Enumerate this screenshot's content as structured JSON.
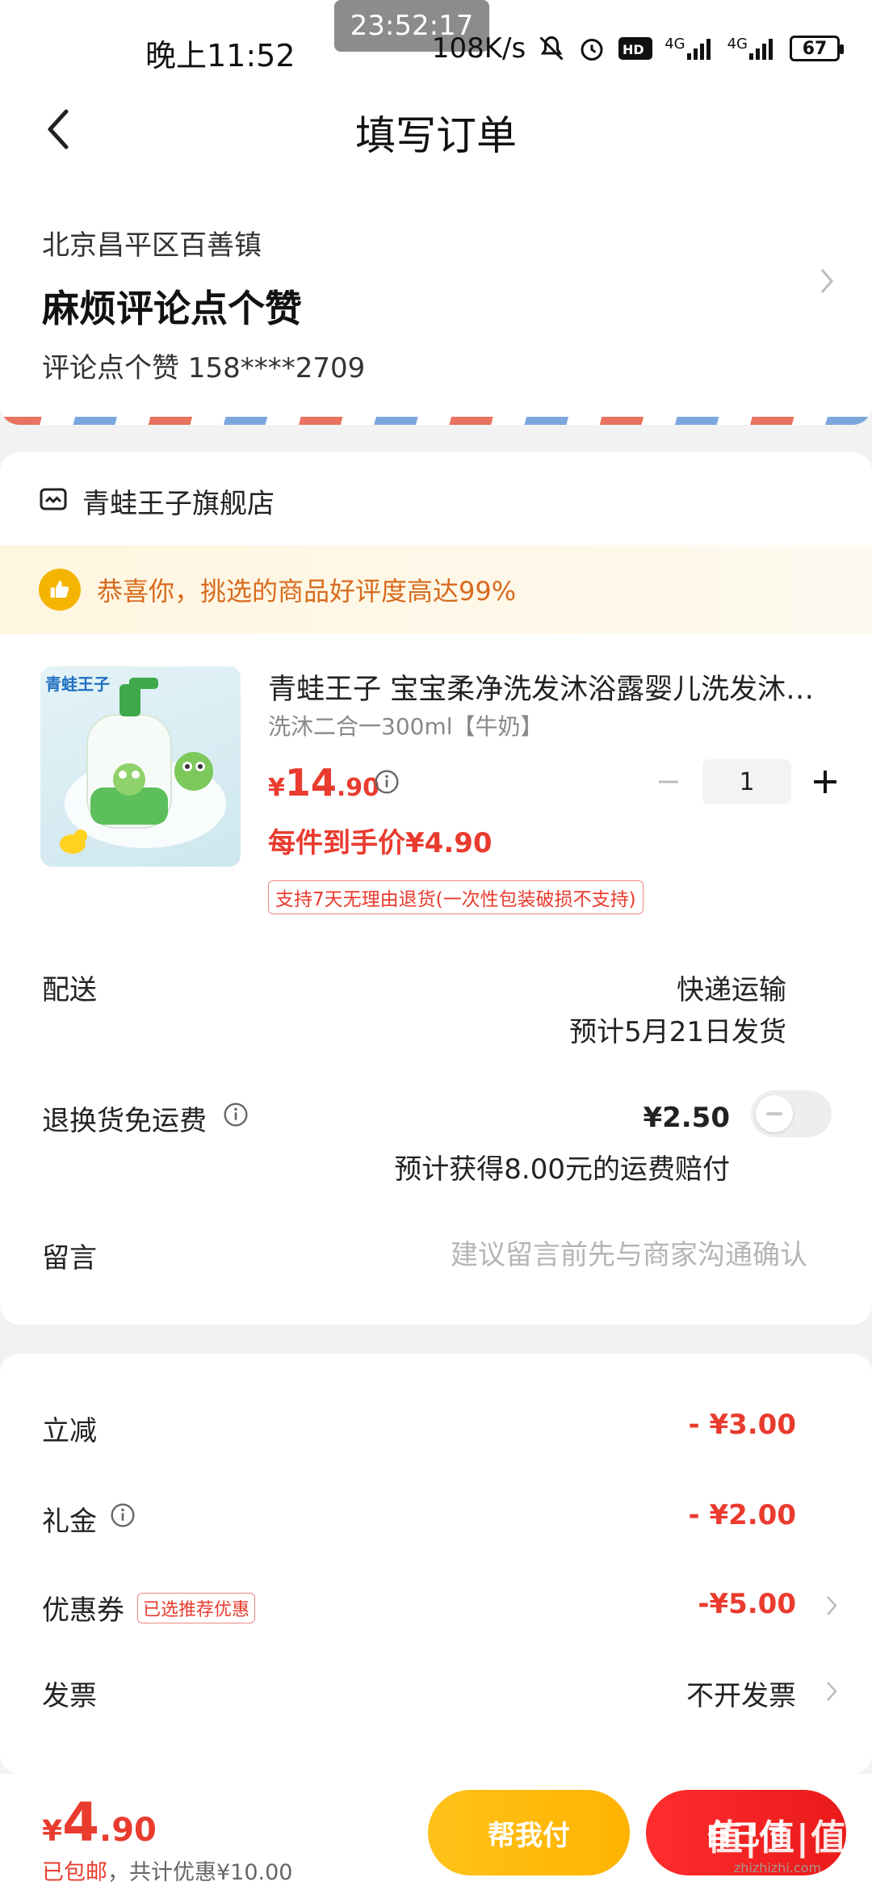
{
  "status_bar": {
    "time": "晚上11:52",
    "clock_overlay": "23:52:17",
    "net_speed": "108K/s",
    "signal_1": "4G",
    "signal_2": "4G",
    "battery": "67"
  },
  "header": {
    "title": "填写订单"
  },
  "address": {
    "region": "北京昌平区百善镇",
    "detail": "麻烦评论点个赞",
    "contact": "评论点个赞  158****2709"
  },
  "shop": {
    "name": "青蛙王子旗舰店"
  },
  "banner": {
    "text": "恭喜你，挑选的商品好评度高达99%"
  },
  "product": {
    "title": "青蛙王子 宝宝柔净洗发沐浴露婴儿洗发沐浴二合一",
    "spec": "洗沐二合一300ml【牛奶】",
    "price_currency": "¥",
    "price_int": "14",
    "price_dec": ".90",
    "quantity": "1",
    "unit_price": "每件到手价¥4.90",
    "return_policy": "支持7天无理由退货(一次性包装破损不支持)",
    "brand_text": "青蛙王子"
  },
  "delivery": {
    "label": "配送",
    "method": "快递运输",
    "eta": "预计5月21日发货"
  },
  "return_insurance": {
    "label": "退换货免运费",
    "price": "¥2.50",
    "note": "预计获得8.00元的运费赔付",
    "enabled": false
  },
  "message": {
    "label": "留言",
    "placeholder": "建议留言前先与商家沟通确认",
    "value": ""
  },
  "summary": {
    "discount_label": "立减",
    "discount_value": "- ¥3.00",
    "gift_label": "礼金",
    "gift_value": "- ¥2.00",
    "coupon_label": "优惠券",
    "coupon_tag": "已选推荐优惠",
    "coupon_value": "-¥5.00",
    "invoice_label": "发票",
    "invoice_value": "不开发票"
  },
  "footer": {
    "total_currency": "¥",
    "total_int": "4",
    "total_dec": ".90",
    "shipping": "已包邮",
    "savings": "，共计优惠¥10.00",
    "help_pay_label": "帮我付",
    "self_pay_label": "自己付"
  },
  "watermark": {
    "logo": "值|值|值",
    "url": "zhizhizhi.com"
  },
  "colors": {
    "accent_red": "#e93b2e",
    "help_yellow": "#ffc21a",
    "banner_orange": "#d86b1e"
  }
}
